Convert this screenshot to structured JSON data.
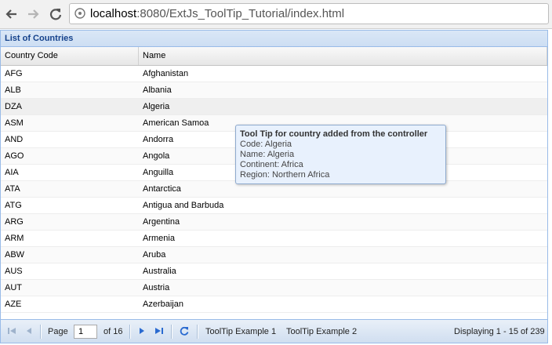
{
  "browser": {
    "url_host": "localhost",
    "url_rest": ":8080/ExtJs_ToolTip_Tutorial/index.html"
  },
  "panel": {
    "title": "List of Countries"
  },
  "grid": {
    "columns": [
      "Country Code",
      "Name"
    ],
    "rows": [
      {
        "code": "AFG",
        "name": "Afghanistan"
      },
      {
        "code": "ALB",
        "name": "Albania"
      },
      {
        "code": "DZA",
        "name": "Algeria"
      },
      {
        "code": "ASM",
        "name": "American Samoa"
      },
      {
        "code": "AND",
        "name": "Andorra"
      },
      {
        "code": "AGO",
        "name": "Angola"
      },
      {
        "code": "AIA",
        "name": "Anguilla"
      },
      {
        "code": "ATA",
        "name": "Antarctica"
      },
      {
        "code": "ATG",
        "name": "Antigua and Barbuda"
      },
      {
        "code": "ARG",
        "name": "Argentina"
      },
      {
        "code": "ARM",
        "name": "Armenia"
      },
      {
        "code": "ABW",
        "name": "Aruba"
      },
      {
        "code": "AUS",
        "name": "Australia"
      },
      {
        "code": "AUT",
        "name": "Austria"
      },
      {
        "code": "AZE",
        "name": "Azerbaijan"
      }
    ]
  },
  "tooltip": {
    "title": "Tool Tip for country added from the controller",
    "lines": [
      "Code: Algeria",
      "Name: Algeria",
      "Continent: Africa",
      "Region: Northern Africa"
    ]
  },
  "paging": {
    "page_label": "Page",
    "page_value": "1",
    "of_label": "of 16",
    "button1": "ToolTip Example 1",
    "button2": "ToolTip Example 2",
    "display_text": "Displaying 1 - 15 of 239"
  },
  "colors": {
    "header_text": "#15428b",
    "border": "#99bbe8"
  }
}
